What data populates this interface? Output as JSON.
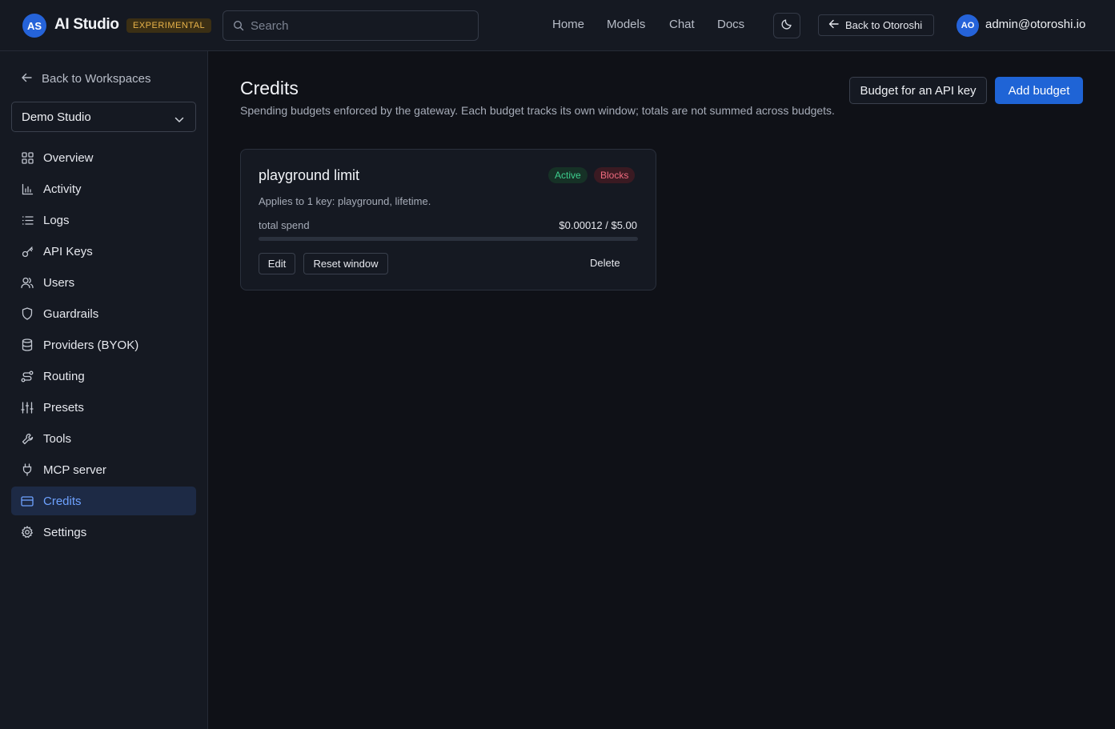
{
  "header": {
    "brand_initials": "AS",
    "brand_name": "AI Studio",
    "badge": "EXPERIMENTAL",
    "search_placeholder": "Search",
    "nav": [
      "Home",
      "Models",
      "Chat",
      "Docs"
    ],
    "theme_icon": "moon-icon",
    "back_label": "Back to Otoroshi",
    "user_initials": "AO",
    "user_email": "admin@otoroshi.io"
  },
  "sidebar": {
    "back_label": "Back to Workspaces",
    "workspace": "Demo Studio",
    "items": [
      {
        "label": "Overview",
        "icon": "grid-icon"
      },
      {
        "label": "Activity",
        "icon": "bar-chart-icon"
      },
      {
        "label": "Logs",
        "icon": "list-icon"
      },
      {
        "label": "API Keys",
        "icon": "key-icon"
      },
      {
        "label": "Users",
        "icon": "users-icon"
      },
      {
        "label": "Guardrails",
        "icon": "shield-icon"
      },
      {
        "label": "Providers (BYOK)",
        "icon": "database-icon"
      },
      {
        "label": "Routing",
        "icon": "route-icon"
      },
      {
        "label": "Presets",
        "icon": "sliders-icon"
      },
      {
        "label": "Tools",
        "icon": "wrench-icon"
      },
      {
        "label": "MCP server",
        "icon": "plug-icon"
      },
      {
        "label": "Credits",
        "icon": "credit-card-icon"
      },
      {
        "label": "Settings",
        "icon": "gear-icon"
      }
    ],
    "active_item": "Credits"
  },
  "main": {
    "title": "Credits",
    "description": "Spending budgets enforced by the gateway. Each budget tracks its own window; totals are not summed across budgets.",
    "budget_for_key_label": "Budget for an API key",
    "add_budget_label": "Add budget",
    "budgets": [
      {
        "name": "playground limit",
        "status": "Active",
        "mode": "Blocks",
        "applies": "Applies to 1 key: playground, lifetime.",
        "spend_label": "total spend",
        "spend_value": "$0.00012 / $5.00",
        "progress_fraction": 2.4e-05,
        "edit_label": "Edit",
        "reset_label": "Reset window",
        "delete_label": "Delete"
      }
    ]
  },
  "colors": {
    "accent": "#1f64d6",
    "active_status": "#3ecf8e",
    "blocks_status": "#f06b7f",
    "badge": "#e8b34a"
  }
}
